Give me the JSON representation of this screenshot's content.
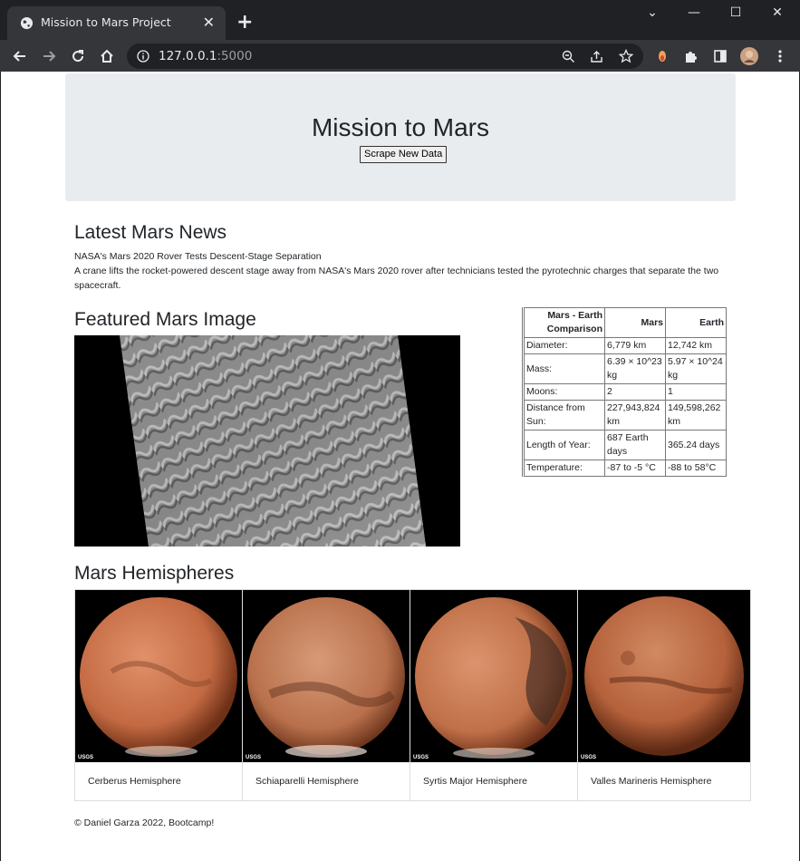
{
  "browser": {
    "tab_title": "Mission to Mars Project",
    "tab_close": "✕",
    "new_tab": "+",
    "url_host": "127.0.0.1",
    "url_port": ":5000",
    "controls": {
      "minimize": "—",
      "maximize": "☐",
      "close": "✕",
      "tab_search": "⌄"
    }
  },
  "page": {
    "title": "Mission to Mars",
    "scrape_button": "Scrape New Data",
    "news": {
      "heading": "Latest Mars News",
      "title": "NASA's Mars 2020 Rover Tests Descent-Stage Separation",
      "paragraph": "A crane lifts the rocket-powered descent stage away from NASA's Mars 2020 rover after technicians tested the pyrotechnic charges that separate the two spacecraft."
    },
    "featured": {
      "heading": "Featured Mars Image"
    },
    "facts": {
      "headers": [
        "Mars - Earth Comparison",
        "Mars",
        "Earth"
      ],
      "rows": [
        [
          "Diameter:",
          "6,779 km",
          "12,742 km"
        ],
        [
          "Mass:",
          "6.39 × 10^23 kg",
          "5.97 × 10^24 kg"
        ],
        [
          "Moons:",
          "2",
          "1"
        ],
        [
          "Distance from Sun:",
          "227,943,824 km",
          "149,598,262 km"
        ],
        [
          "Length of Year:",
          "687 Earth days",
          "365.24 days"
        ],
        [
          "Temperature:",
          "-87 to -5 °C",
          "-88 to 58°C"
        ]
      ]
    },
    "hemispheres": {
      "heading": "Mars Hemispheres",
      "items": [
        {
          "label": "Cerberus Hemisphere",
          "color": "#c46a43"
        },
        {
          "label": "Schiaparelli Hemisphere",
          "color": "#b9714c"
        },
        {
          "label": "Syrtis Major Hemisphere",
          "color": "#c07048"
        },
        {
          "label": "Valles Marineris Hemisphere",
          "color": "#b5613b"
        }
      ],
      "watermark": "USGS"
    },
    "footer": "© Daniel Garza 2022, Bootcamp!"
  }
}
